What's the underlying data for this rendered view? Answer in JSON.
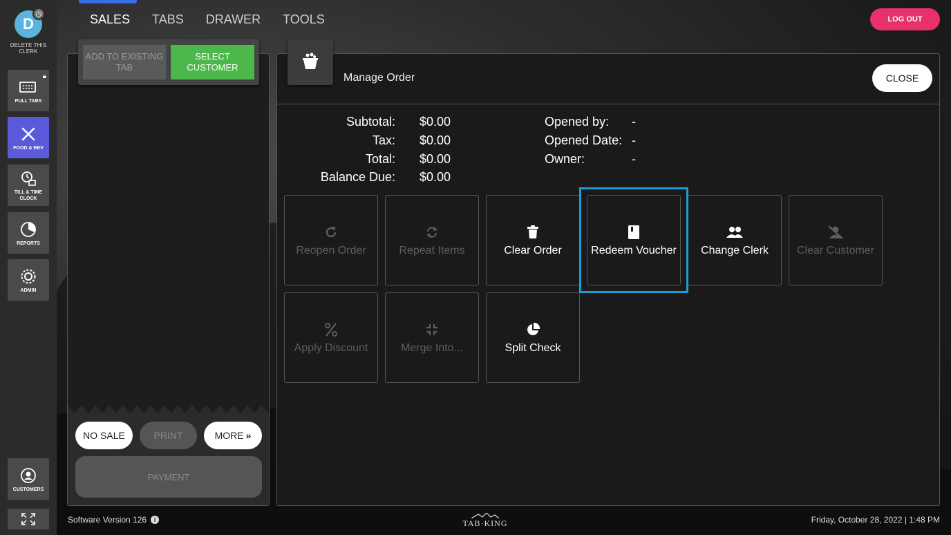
{
  "clerk": {
    "initial": "D",
    "delete_label": "DELETE THIS CLERK"
  },
  "rail": {
    "items": [
      {
        "label": "PULL TABS",
        "icon": "pull-tabs-icon",
        "locked": true
      },
      {
        "label": "FOOD & BEV",
        "icon": "fork-knife-icon",
        "active": true
      },
      {
        "label": "TILL & TIME CLOCK",
        "icon": "till-clock-icon"
      },
      {
        "label": "REPORTS",
        "icon": "pie-chart-icon"
      },
      {
        "label": "ADMIN",
        "icon": "gear-icon"
      }
    ],
    "customers_label": "CUSTOMERS"
  },
  "nav": {
    "tabs": [
      "SALES",
      "TABS",
      "DRAWER",
      "TOOLS"
    ],
    "active": "SALES",
    "logout": "LOG OUT"
  },
  "ticket": {
    "add_existing": "ADD TO EXISTING TAB",
    "select_customer": "SELECT CUSTOMER",
    "no_sale": "NO SALE",
    "print": "PRINT",
    "more": "MORE",
    "payment": "PAYMENT"
  },
  "manage": {
    "title": "Manage Order",
    "close": "CLOSE",
    "summary": [
      {
        "label": "Subtotal:",
        "value": "$0.00"
      },
      {
        "label": "Tax:",
        "value": "$0.00"
      },
      {
        "label": "Total:",
        "value": "$0.00"
      },
      {
        "label": "Balance Due:",
        "value": "$0.00"
      }
    ],
    "info": [
      {
        "label": "Opened by:",
        "value": "-"
      },
      {
        "label": "Opened Date:",
        "value": "-"
      },
      {
        "label": "Owner:",
        "value": "-"
      }
    ],
    "actions": [
      {
        "label": "Reopen Order",
        "icon": "redo-icon",
        "enabled": false
      },
      {
        "label": "Repeat Items",
        "icon": "sync-icon",
        "enabled": false
      },
      {
        "label": "Clear Order",
        "icon": "trash-icon",
        "enabled": true
      },
      {
        "label": "Redeem Voucher",
        "icon": "book-icon",
        "enabled": true
      },
      {
        "label": "Change Clerk",
        "icon": "users-icon",
        "enabled": true
      },
      {
        "label": "Clear Customer",
        "icon": "user-slash-icon",
        "enabled": false
      },
      {
        "label": "Apply Discount",
        "icon": "percent-icon",
        "enabled": false
      },
      {
        "label": "Merge Into...",
        "icon": "compress-icon",
        "enabled": false
      },
      {
        "label": "Split Check",
        "icon": "pie-icon",
        "enabled": true
      }
    ]
  },
  "footer": {
    "version": "Software Version 126",
    "logo": "TAB·KING",
    "datetime": "Friday, October 28, 2022  |  1:48 PM"
  }
}
